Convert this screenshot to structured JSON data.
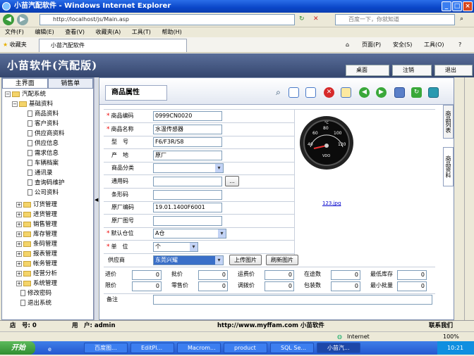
{
  "window": {
    "title": "小苗汽配软件 - Windows Internet Explorer",
    "buttons": [
      "_",
      "□",
      "×"
    ]
  },
  "browser": {
    "address": "http://localhost/js/Main.asp",
    "search_placeholder": "百度一下，你就知道",
    "menu": [
      "文件(F)",
      "编辑(E)",
      "查看(V)",
      "收藏夹(A)",
      "工具(T)",
      "帮助(H)"
    ],
    "favorites": "收藏夹",
    "tab": "小苗汽配软件",
    "toolbar": [
      "页面(P)",
      "安全(S)",
      "工具(O)"
    ]
  },
  "app": {
    "title": "小苗软件(汽配版)",
    "header_tabs": [
      "桌面",
      "注销",
      "退出"
    ],
    "side_tabs": [
      "主界面",
      "销售单"
    ],
    "tree": {
      "root": "汽配系统",
      "basic": "基础资料",
      "basic_items": [
        "商品资料",
        "客户资料",
        "供应商资料",
        "供应信息",
        "需求信息",
        "车辆档案",
        "通讯录",
        "查询码维护",
        "公司资料"
      ],
      "groups": [
        "订货管理",
        "进货管理",
        "销售管理",
        "库存管理",
        "条码管理",
        "报表管理",
        "帐务管理",
        "经营分析",
        "系统管理"
      ],
      "leaves": [
        "修改密码",
        "退出系统"
      ]
    },
    "main": {
      "title": "商品属性",
      "vtabs": [
        "商品列表",
        "商品资料"
      ],
      "fields": [
        {
          "label": "商品编码",
          "value": "0999CN0020",
          "required": true
        },
        {
          "label": "商品名称",
          "value": "水温传感器",
          "required": true
        },
        {
          "label": "型　号",
          "value": "F6/F3R/S8",
          "required": false
        },
        {
          "label": "产　地",
          "value": "原厂",
          "required": false
        },
        {
          "label": "商品分类",
          "value": "",
          "required": false
        },
        {
          "label": "通用码",
          "value": "",
          "required": false
        },
        {
          "label": "条形码",
          "value": "",
          "required": false
        },
        {
          "label": "原厂编码",
          "value": "19.01.1400F6001",
          "required": false
        },
        {
          "label": "原厂图号",
          "value": "",
          "required": false
        },
        {
          "label": "默认仓位",
          "value": "A仓",
          "required": true
        },
        {
          "label": "单　位",
          "value": "个",
          "required": true
        }
      ],
      "supplier_label": "供应商",
      "supplier_value": "东莞兴耀",
      "lookup_button": "...",
      "upload_button": "上传图片",
      "refresh_button": "刷新图片",
      "image_caption": "123.jpg",
      "gauge_label": "VDO",
      "gauge_unit": "°C",
      "gauge_ticks": [
        "40",
        "60",
        "80",
        "100",
        "120"
      ],
      "prices_row1": [
        {
          "label": "进价",
          "value": "0"
        },
        {
          "label": "批价",
          "value": "0"
        },
        {
          "label": "运费价",
          "value": "0"
        },
        {
          "label": "在途数",
          "value": "0"
        },
        {
          "label": "最低库存",
          "value": "0"
        }
      ],
      "prices_row2": [
        {
          "label": "限价",
          "value": "0"
        },
        {
          "label": "零售价",
          "value": "0"
        },
        {
          "label": "调拨价",
          "value": "0"
        },
        {
          "label": "包装数",
          "value": "0"
        },
        {
          "label": "最小批量",
          "value": "0"
        }
      ],
      "remark_label": "备注"
    },
    "status": {
      "shop": "店　号: 0",
      "user": "用　户: admin",
      "site": "http://www.myffam.com 小苗软件",
      "contact": "联系我们"
    }
  },
  "ie_status": {
    "zone": "Internet",
    "zoom": "100%"
  },
  "taskbar": {
    "start": "开始",
    "tasks": [
      "百度图...",
      "EditPl...",
      "Macrom...",
      "product",
      "SQL Se...",
      "小苗汽..."
    ],
    "clock": "10:21"
  },
  "colors": {
    "title_bar": "#0a46c8",
    "app_header": "#34466e",
    "required": "#e00000"
  }
}
